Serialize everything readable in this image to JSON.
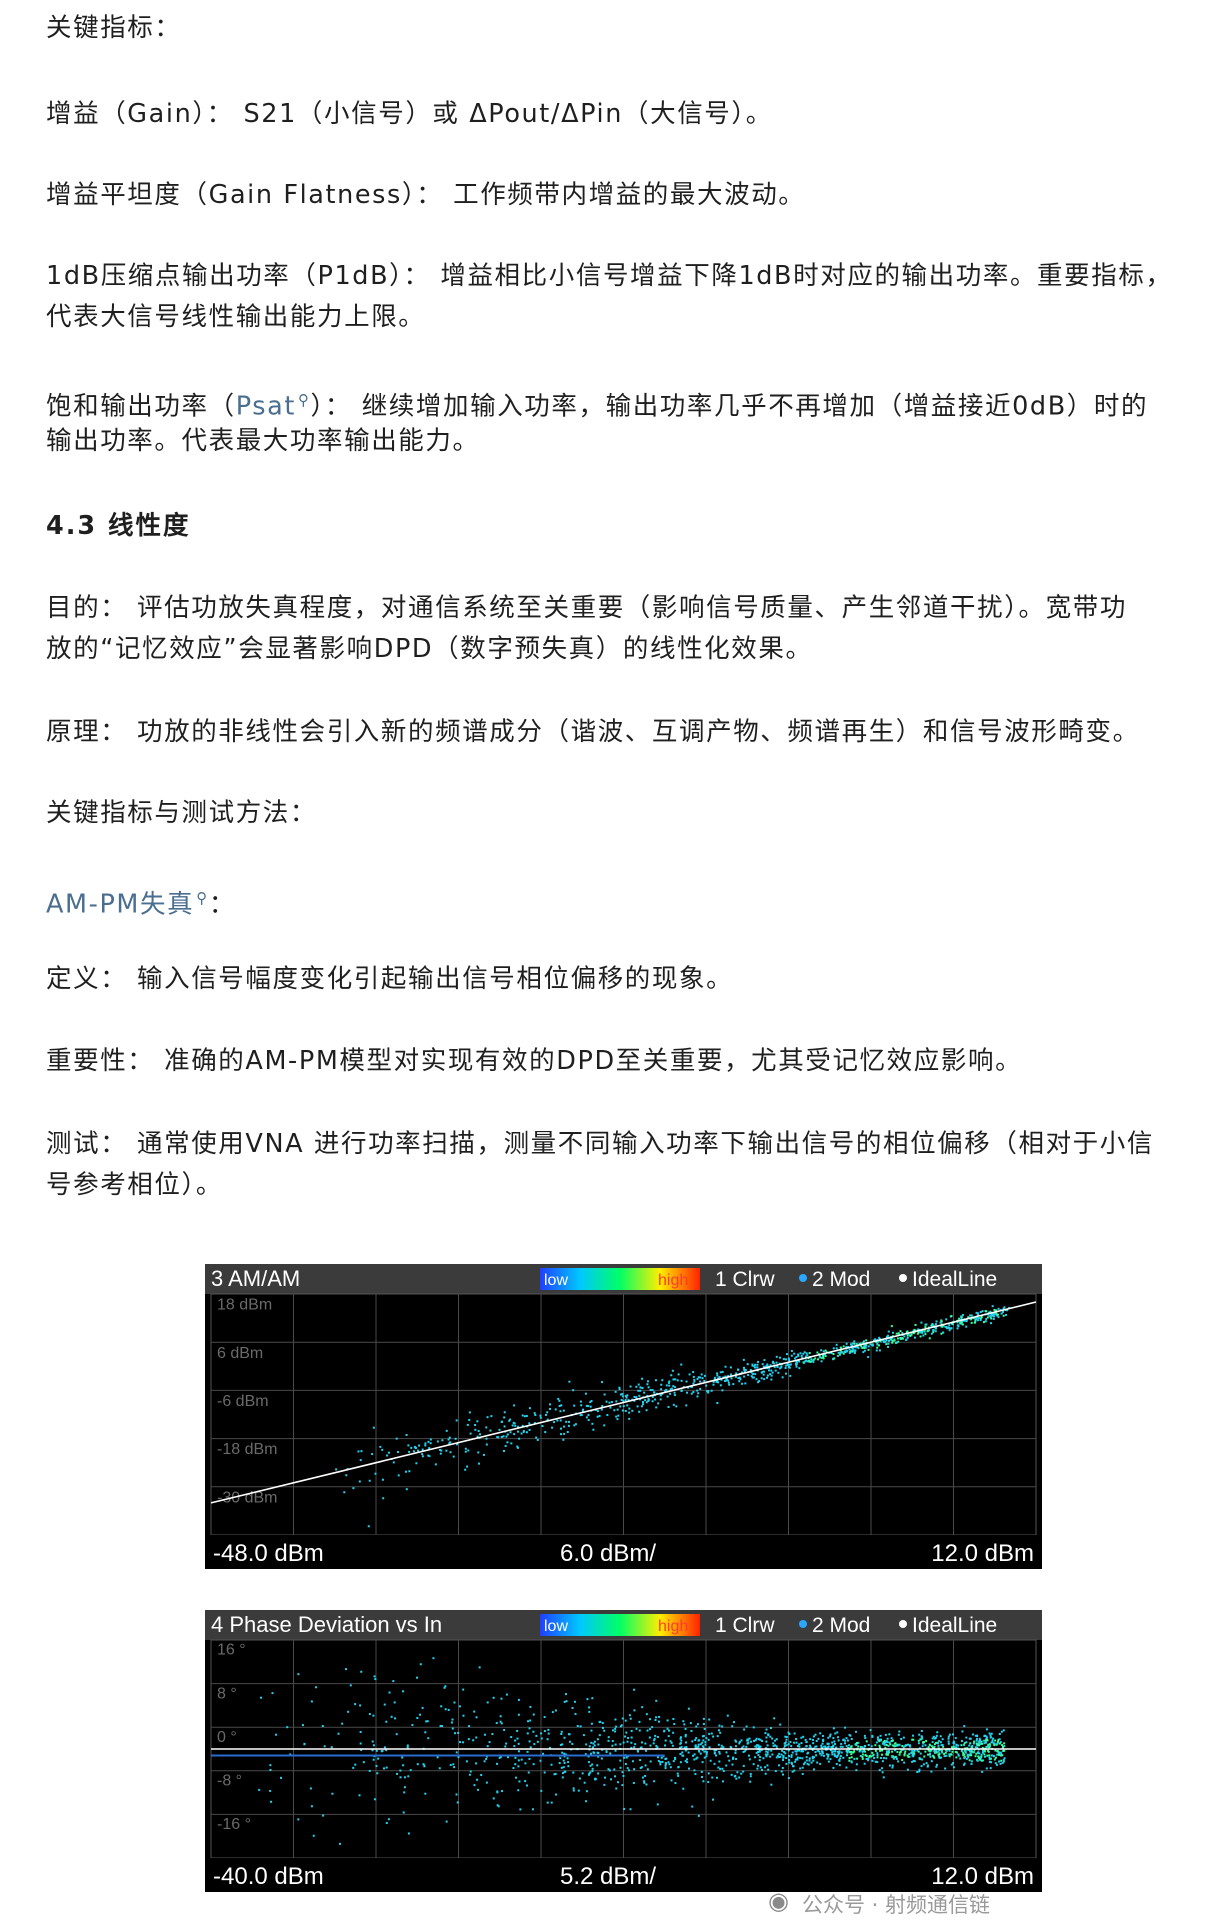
{
  "text": {
    "p1": "关键指标：",
    "p2": "增益（Gain）： S21（小信号）或 ΔPout/ΔPin（大信号）。",
    "p3": "增益平坦度（Gain Flatness）： 工作频带内增益的最大波动。",
    "p4a": "1dB压缩点输出功率（P1dB）： 增益相比小信号增益下降1dB时对应的输出功率。重要指标，",
    "p4b": "代表大信号线性输出能力上限。",
    "p5a_pre": "饱和输出功率（",
    "p5a_link": "Psat",
    "p5a_post": "）： 继续增加输入功率，输出功率几乎不再增加（增益接近0dB）时的",
    "p5b": "输出功率。代表最大功率输出能力。",
    "h43": "4.3 线性度",
    "p6a": "目的： 评估功放失真程度，对通信系统至关重要（影响信号质量、产生邻道干扰）。宽带功",
    "p6b": "放的“记忆效应”会显著影响DPD（数字预失真）的线性化效果。",
    "p7": "原理： 功放的非线性会引入新的频谱成分（谐波、互调产物、频谱再生）和信号波形畸变。",
    "p8": "关键指标与测试方法：",
    "p9_link": "AM-PM失真",
    "p9_post": "：",
    "p10": "定义： 输入信号幅度变化引起输出信号相位偏移的现象。",
    "p11": "重要性： 准确的AM-PM模型对实现有效的DPD至关重要，尤其受记忆效应影响。",
    "p12a": "测试： 通常使用VNA 进行功率扫描，测量不同输入功率下输出信号的相位偏移（相对于小信",
    "p12b": "号参考相位）。",
    "watermark": "公众号 · 射频通信链"
  },
  "chart_data": [
    {
      "type": "scatter",
      "title": "3 AM/AM",
      "legend": [
        "low",
        "high",
        "1 Clrw",
        "2 Mod",
        "IdealLine"
      ],
      "y_ticks": [
        "18 dBm",
        "6 dBm",
        "-6 dBm",
        "-18 dBm",
        "-30 dBm"
      ],
      "x_start": "-48.0 dBm",
      "x_div": "6.0 dBm/",
      "x_stop": "12.0 dBm",
      "xlim": [
        -48,
        12
      ],
      "ylim": [
        -36,
        24
      ],
      "ideal_line": [
        [
          -48,
          -28
        ],
        [
          12,
          22
        ]
      ]
    },
    {
      "type": "scatter",
      "title": "4 Phase Deviation vs In",
      "legend": [
        "low",
        "high",
        "1 Clrw",
        "2 Mod",
        "IdealLine"
      ],
      "y_ticks": [
        "16 °",
        "8 °",
        "0 °",
        "-8 °",
        "-16 °"
      ],
      "x_start": "-40.0 dBm",
      "x_div": "5.2 dBm/",
      "x_stop": "12.0 dBm",
      "xlim": [
        -40,
        12
      ],
      "ylim": [
        -20,
        20
      ],
      "ideal_line": [
        [
          -40,
          0
        ],
        [
          12,
          0
        ]
      ]
    }
  ],
  "colors": {
    "accent_link": "#4a6e8f",
    "scatter": "#22d3f0",
    "ideal": "#ffffff"
  }
}
